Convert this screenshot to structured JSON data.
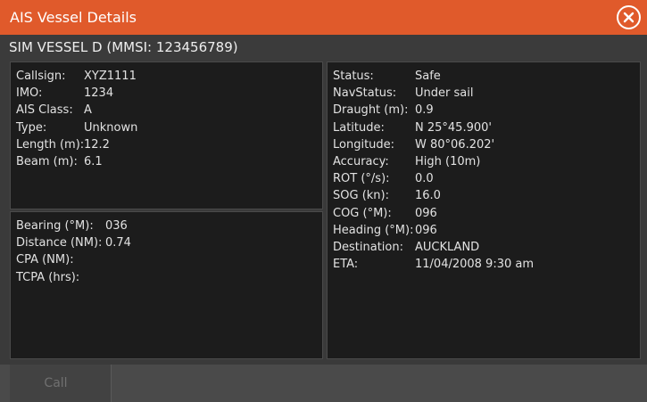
{
  "window": {
    "title": "AIS Vessel Details",
    "close_icon": "close-circle-icon",
    "accent_color": "#e05a2b"
  },
  "vessel": {
    "heading": "SIM VESSEL D (MMSI: 123456789)"
  },
  "identity": [
    {
      "label": "Callsign:",
      "value": "XYZ1111"
    },
    {
      "label": "IMO:",
      "value": "1234"
    },
    {
      "label": "AIS Class:",
      "value": "A"
    },
    {
      "label": "Type:",
      "value": "Unknown"
    },
    {
      "label": "Length (m):",
      "value": "12.2"
    },
    {
      "label": "Beam (m):",
      "value": "6.1"
    }
  ],
  "navigation": [
    {
      "label": "Bearing (°M):",
      "value": "036"
    },
    {
      "label": "Distance (NM):",
      "value": "0.74"
    },
    {
      "label": "CPA (NM):",
      "value": ""
    },
    {
      "label": "TCPA (hrs):",
      "value": ""
    }
  ],
  "status": [
    {
      "label": "Status:",
      "value": "Safe"
    },
    {
      "label": "NavStatus:",
      "value": "Under sail"
    },
    {
      "label": "Draught (m):",
      "value": "0.9"
    },
    {
      "label": "Latitude:",
      "value": "N  25°45.900'"
    },
    {
      "label": "Longitude:",
      "value": "W  80°06.202'"
    },
    {
      "label": "Accuracy:",
      "value": "High (10m)"
    },
    {
      "label": "ROT (°/s):",
      "value": "0.0"
    },
    {
      "label": "SOG (kn):",
      "value": "16.0"
    },
    {
      "label": "COG (°M):",
      "value": "096"
    },
    {
      "label": "Heading (°M):",
      "value": "096"
    },
    {
      "label": "Destination:",
      "value": "AUCKLAND"
    },
    {
      "label": "ETA:",
      "value": "11/04/2008 9:30 am"
    }
  ],
  "actions": {
    "call_label": "Call"
  }
}
